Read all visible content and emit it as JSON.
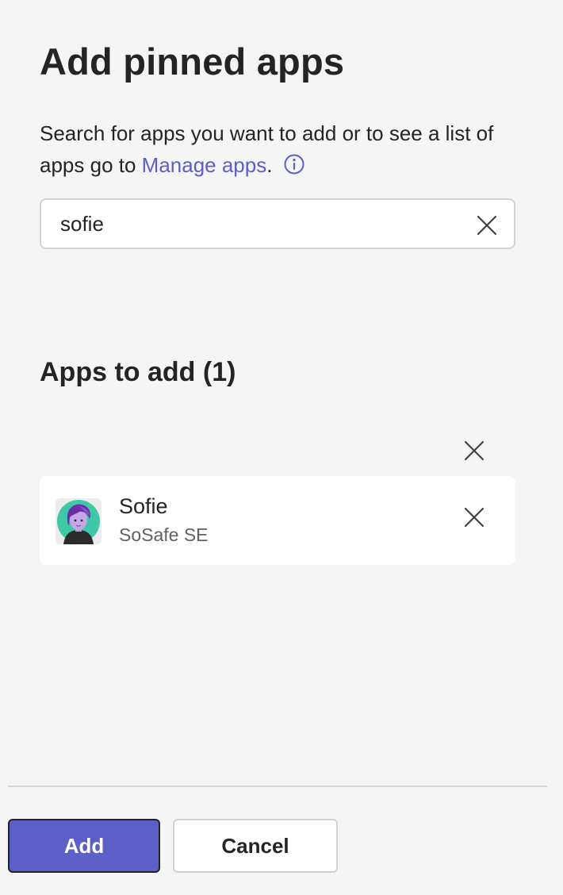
{
  "dialog": {
    "title": "Add pinned apps",
    "description_prefix": "Search for apps you want to add or to see a list of apps go to ",
    "manage_apps_link": "Manage apps",
    "description_suffix": ".",
    "info_icon": "info-icon"
  },
  "search": {
    "value": "sofie",
    "clear_icon": "close-icon"
  },
  "apps_section": {
    "heading": "Apps to add (1)",
    "clear_all_icon": "close-icon",
    "items": [
      {
        "name": "Sofie",
        "publisher": "SoSafe SE",
        "avatar_icon": "sofie-avatar",
        "remove_icon": "close-icon"
      }
    ]
  },
  "footer": {
    "add_label": "Add",
    "cancel_label": "Cancel"
  },
  "colors": {
    "accent": "#5b5fc7",
    "background": "#f5f5f5",
    "card": "#ffffff",
    "text": "#242424",
    "secondary_text": "#616161"
  }
}
